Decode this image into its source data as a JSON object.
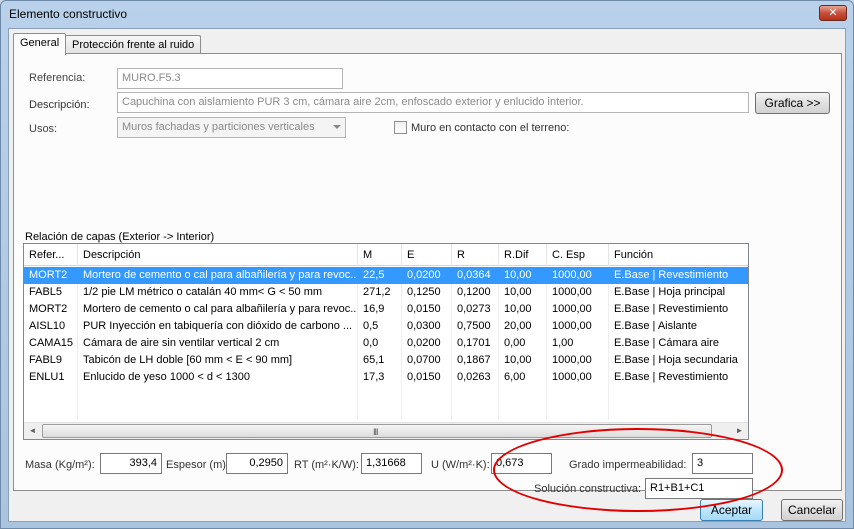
{
  "window": {
    "title": "Elemento constructivo",
    "close_glyph": "✕"
  },
  "tabs": [
    {
      "label": "General",
      "active": true
    },
    {
      "label": "Protección frente al ruido",
      "active": false
    }
  ],
  "form": {
    "referencia_label": "Referencia:",
    "referencia_value": "MURO.F5.3",
    "descripcion_label": "Descripción:",
    "descripcion_value": "Capuchina con aislamiento PUR 3 cm, cámara aire 2cm, enfoscado exterior y enlucido interior.",
    "grafica_button": "Grafica >>",
    "usos_label": "Usos:",
    "usos_value": "Muros fachadas y particiones verticales",
    "terreno_label": "Muro en contacto con el terreno:",
    "terreno_checked": false
  },
  "layers": {
    "caption": "Relación de capas (Exterior -> Interior)",
    "columns": [
      "Refer...",
      "Descripción",
      "M",
      "E",
      "R",
      "R.Dif",
      "C. Esp",
      "Función"
    ],
    "rows": [
      [
        "MORT2",
        "Mortero de cemento o cal para albañilería y para revoc...",
        "22,5",
        "0,0200",
        "0,0364",
        "10,00",
        "1000,00",
        "E.Base | Revestimiento"
      ],
      [
        "FABL5",
        "1/2 pie LM métrico o catalán 40 mm< G < 50 mm",
        "271,2",
        "0,1250",
        "0,1200",
        "10,00",
        "1000,00",
        "E.Base | Hoja principal"
      ],
      [
        "MORT2",
        "Mortero de cemento o cal para albañilería y para revoc...",
        "16,9",
        "0,0150",
        "0,0273",
        "10,00",
        "1000,00",
        "E.Base | Revestimiento"
      ],
      [
        "AISL10",
        "PUR Inyección en tabiquería con dióxido de carbono ...",
        "0,5",
        "0,0300",
        "0,7500",
        "20,00",
        "1000,00",
        "E.Base | Aislante"
      ],
      [
        "CAMA15",
        "Cámara de aire sin ventilar vertical 2 cm",
        "0,0",
        "0,0200",
        "0,1701",
        "0,00",
        "1,00",
        "E.Base | Cámara aire"
      ],
      [
        "FABL9",
        "Tabicón de LH doble [60 mm < E < 90 mm]",
        "65,1",
        "0,0700",
        "0,1867",
        "10,00",
        "1000,00",
        "E.Base | Hoja secundaria"
      ],
      [
        "ENLU1",
        "Enlucido de yeso 1000 < d < 1300",
        "17,3",
        "0,0150",
        "0,0263",
        "6,00",
        "1000,00",
        "E.Base | Revestimiento"
      ]
    ],
    "selected_row": 0,
    "scroll_left": "◄",
    "scroll_right": "►",
    "scroll_grip": "III"
  },
  "summary": {
    "masa_label": "Masa (Kg/m²):",
    "masa_value": "393,4",
    "espesor_label": "Espesor (m):",
    "espesor_value": "0,2950",
    "rt_label": "RT (m²·K/W):",
    "rt_value": "1,31668",
    "u_label": "U (W/m²·K):",
    "u_value": "0,673",
    "grado_label": "Grado impermeabilidad:",
    "grado_value": "3",
    "solucion_label": "Solución constructiva:",
    "solucion_value": "R1+B1+C1"
  },
  "buttons": {
    "accept": "Aceptar",
    "cancel": "Cancelar"
  },
  "colors": {
    "selection": "#3399ff",
    "annotation": "#e00000"
  }
}
